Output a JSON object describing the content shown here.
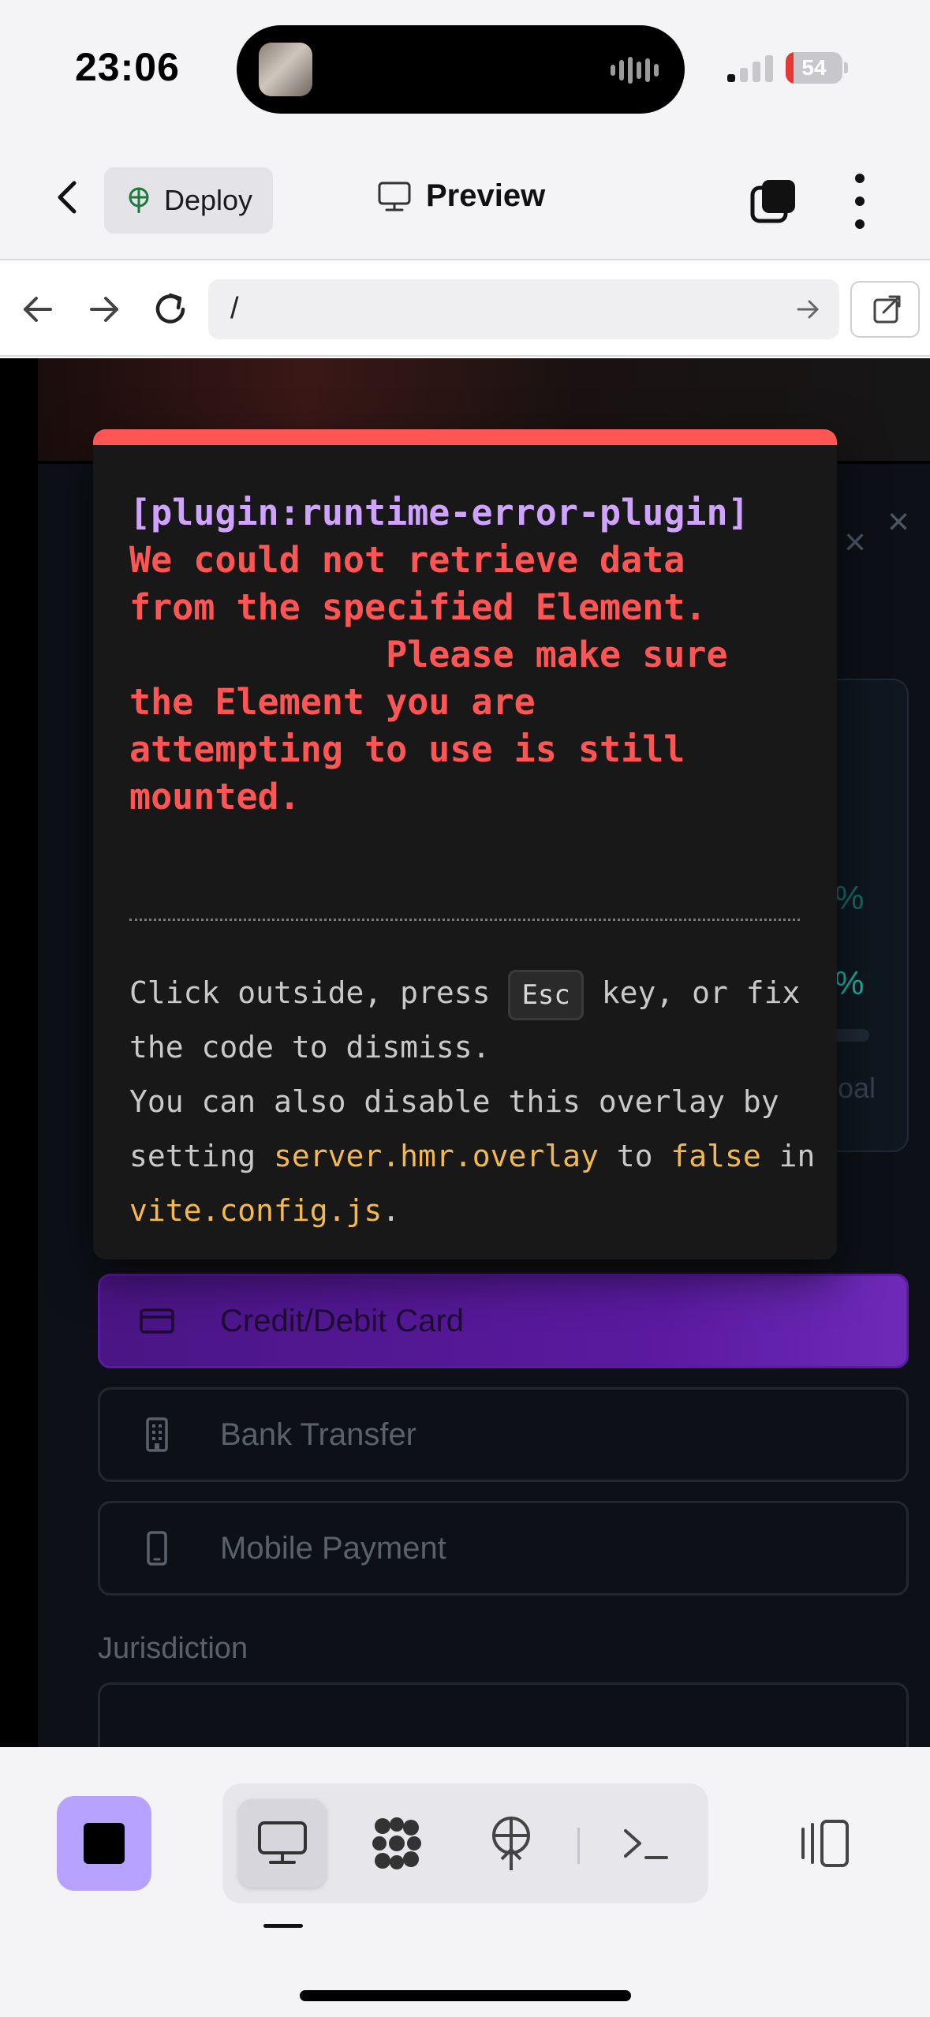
{
  "status_bar": {
    "time": "23:06",
    "battery_level": "54"
  },
  "header": {
    "deploy_label": "Deploy",
    "preview_label": "Preview"
  },
  "browser": {
    "url": "/"
  },
  "background_page": {
    "payment_options": [
      {
        "label": "Credit/Debit Card",
        "icon": "credit-card-icon",
        "selected": true
      },
      {
        "label": "Bank Transfer",
        "icon": "building-icon",
        "selected": false
      },
      {
        "label": "Mobile Payment",
        "icon": "phone-icon",
        "selected": false
      }
    ],
    "jurisdiction_label": "Jurisdiction"
  },
  "error_overlay": {
    "plugin": "[plugin:runtime-error-plugin]",
    "message": "We could not retrieve data\nfrom the specified Element.\n            Please make sure\nthe Element you are\nattempting to use is still\nmounted.",
    "tip_1": "Click outside, press ",
    "esc_key": "Esc",
    "tip_2": " key, or fix the code to dismiss.",
    "tip_3": "You can also disable this overlay by setting ",
    "config_key": "server.hmr.overlay",
    "tip_4": " to ",
    "config_value": "false",
    "tip_5": " in ",
    "config_file": "vite.config.js",
    "tip_6": "."
  },
  "colors": {
    "overlay_accent": "#ff5555",
    "plugin_text": "#cfa3ff",
    "code_text": "#f1b94e",
    "stop_button": "#b7a2ff",
    "selected_option": "#5b1aa0"
  }
}
